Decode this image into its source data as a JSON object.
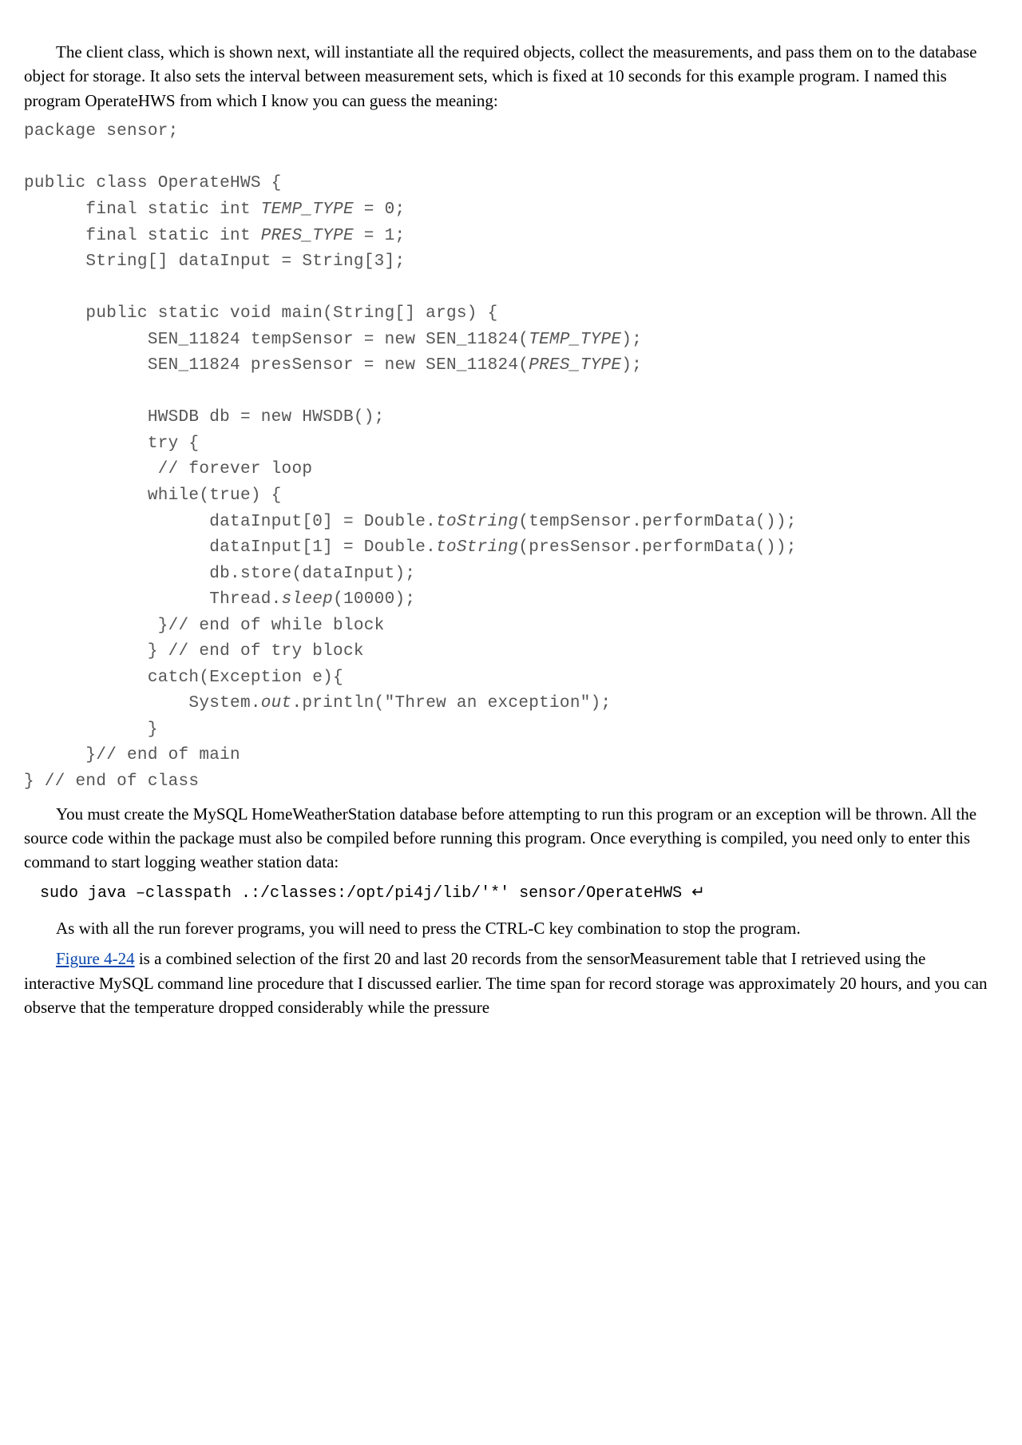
{
  "paragraphs": {
    "p1": "The client class, which is shown next, will instantiate all the required objects, collect the measurements, and pass them on to the database object for storage. It also sets the interval between measurement sets, which is fixed at 10 seconds for this example program. I named this program OperateHWS from which I know you can guess the meaning:",
    "p2": "You must create the MySQL HomeWeatherStation database before attempting to run this program or an exception will be thrown. All the source code within the package must also be compiled before running this program. Once everything is compiled, you need only to enter this command to start logging weather station data:",
    "p3a": "As with all the run forever programs, you will need to press the ",
    "p3ctrl": "CTRL-C",
    "p3b": " key combination to stop the program.",
    "p4fig": "Figure 4-24",
    "p4rest": " is a combined selection of the first 20 and last 20 records from the sensorMeasurement table that I retrieved using the interactive MySQL command line procedure that I discussed earlier. The time span for record storage was approximately 20 hours, and you can observe that the temperature dropped considerably while the pressure"
  },
  "code": {
    "l1": "package sensor;",
    "l2": "",
    "l3": "public class OperateHWS {",
    "l4a": "      final static int ",
    "l4i": "TEMP_TYPE",
    "l4b": " = 0;",
    "l5a": "      final static int ",
    "l5i": "PRES_TYPE",
    "l5b": " = 1;",
    "l6": "      String[] dataInput = String[3];",
    "l7": "",
    "l8": "      public static void main(String[] args) {",
    "l9a": "            SEN_11824 tempSensor = new SEN_11824(",
    "l9i": "TEMP_TYPE",
    "l9b": ");",
    "l10a": "            SEN_11824 presSensor = new SEN_11824(",
    "l10i": "PRES_TYPE",
    "l10b": ");",
    "l11": "",
    "l12": "            HWSDB db = new HWSDB();",
    "l13": "            try {",
    "l14": "             // forever loop",
    "l15": "            while(true) {",
    "l16a": "                  dataInput[0] = Double.",
    "l16i": "toString",
    "l16b": "(tempSensor.performData());",
    "l17a": "                  dataInput[1] = Double.",
    "l17i": "toString",
    "l17b": "(presSensor.performData());",
    "l18": "                  db.store(dataInput);",
    "l19a": "                  Thread.",
    "l19i": "sleep",
    "l19b": "(10000);",
    "l20": "             }// end of while block",
    "l21": "            } // end of try block",
    "l22": "            catch(Exception e){",
    "l23a": "                System.",
    "l23i": "out",
    "l23b": ".println(\"Threw an exception\");",
    "l24": "            }",
    "l25": "      }// end of main",
    "l26": "} // end of class"
  },
  "command": {
    "text": "sudo java –classpath .:/classes:/opt/pi4j/lib/'*' sensor/OperateHWS ",
    "ret": "↵"
  }
}
